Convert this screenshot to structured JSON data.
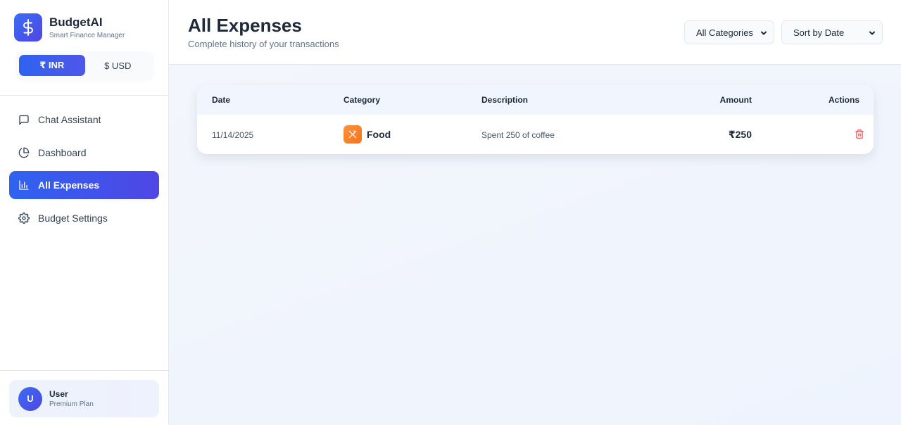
{
  "brand": {
    "name": "BudgetAI",
    "subtitle": "Smart Finance Manager",
    "logo_icon": "dollar-icon"
  },
  "currency": {
    "options": [
      {
        "label": "₹ INR",
        "active": true
      },
      {
        "label": "$ USD",
        "active": false
      }
    ]
  },
  "nav": {
    "items": [
      {
        "label": "Chat Assistant",
        "icon": "chat-icon",
        "active": false
      },
      {
        "label": "Dashboard",
        "icon": "pie-chart-icon",
        "active": false
      },
      {
        "label": "All Expenses",
        "icon": "bar-chart-icon",
        "active": true
      },
      {
        "label": "Budget Settings",
        "icon": "gear-icon",
        "active": false
      }
    ]
  },
  "user": {
    "initial": "U",
    "name": "User",
    "plan": "Premium Plan"
  },
  "header": {
    "title": "All Expenses",
    "subtitle": "Complete history of your transactions",
    "category_filter": "All Categories",
    "sort": "Sort by Date"
  },
  "table": {
    "columns": {
      "date": "Date",
      "category": "Category",
      "description": "Description",
      "amount": "Amount",
      "actions": "Actions"
    },
    "rows": [
      {
        "date": "11/14/2025",
        "category": "Food",
        "category_icon": "utensils-icon",
        "description": "Spent 250 of coffee",
        "amount": "₹250",
        "action_icon": "trash-icon"
      }
    ]
  },
  "colors": {
    "accent": "#3b6cf3",
    "accent_end": "#4f46e5",
    "food": "#f97316",
    "danger": "#ef4444"
  }
}
